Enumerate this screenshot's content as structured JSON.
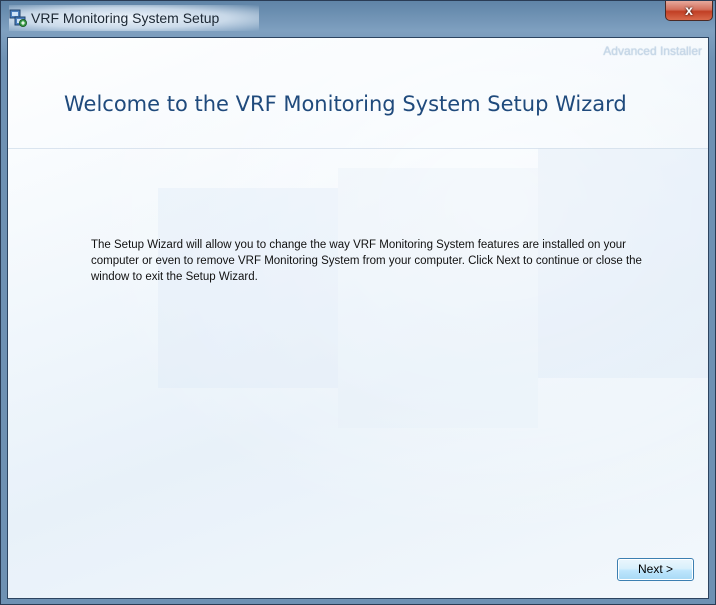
{
  "window": {
    "title": "VRF Monitoring System Setup",
    "close_label": "x"
  },
  "brand": {
    "text": "Advanced Installer"
  },
  "wizard": {
    "heading": "Welcome to the VRF Monitoring System Setup Wizard",
    "body": "The Setup Wizard will allow you to change the way VRF Monitoring System features are installed on your computer or even to remove VRF Monitoring System from your computer.  Click Next to continue or close the window to exit the Setup Wizard."
  },
  "buttons": {
    "next_label": "Next >"
  },
  "icons": {
    "app_icon": "installer-icon",
    "close_icon": "close-icon"
  },
  "colors": {
    "heading": "#1f4a7c",
    "close_button": "#c13f24",
    "next_button_border": "#3c7fb1"
  }
}
